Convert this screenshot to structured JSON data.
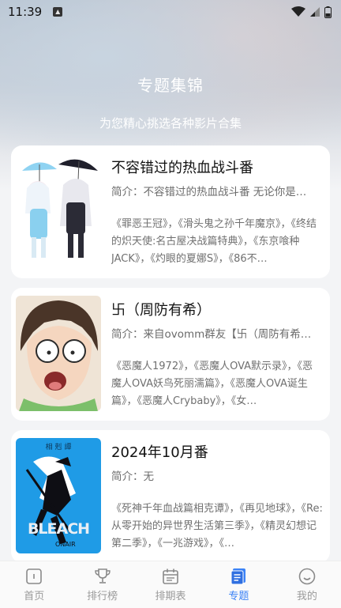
{
  "status": {
    "time": "11:39"
  },
  "header": {
    "title": "专题集锦",
    "subtitle": "为您精心挑选各种影片合集"
  },
  "cards": [
    {
      "title": "不容错过的热血战斗番",
      "intro": "简介：不容错过的热血战斗番 无论你是…",
      "list": "《罪恶王冠》，《滑头鬼之孙千年魔京》，《终结的炽天使:名古屋决战篇特典》，《东京喰种JACK》，《灼眼的夏娜S》，《86不…"
    },
    {
      "title": "卐（周防有希）",
      "intro": "简介：来自ovomm群友【卐（周防有希…",
      "list": "《恶魔人1972》，《恶魔人OVA默示录》，《恶魔人OVA妖鸟死丽濡篇》，《恶魔人OVA诞生篇》，《恶魔人Crybaby》，《女…"
    },
    {
      "title": "2024年10月番",
      "intro": "简介：无",
      "list": "《死神千年血战篇相克谭》，《再见地球》，《Re:从零开始的异世界生活第三季》，《精灵幻想记第二季》，《一兆游戏》，《…"
    }
  ],
  "thumb3": {
    "caption": "相 剋 譚",
    "logo": "BLEACH",
    "onair": "ONAIR"
  },
  "nav": [
    {
      "label": "首页",
      "icon": "home-icon",
      "active": false
    },
    {
      "label": "排行榜",
      "icon": "trophy-icon",
      "active": false
    },
    {
      "label": "排期表",
      "icon": "calendar-icon",
      "active": false
    },
    {
      "label": "专题",
      "icon": "topic-icon",
      "active": true
    },
    {
      "label": "我的",
      "icon": "profile-icon",
      "active": false
    }
  ],
  "colors": {
    "accent": "#3b82f6",
    "inactive": "#9a9a9a"
  }
}
